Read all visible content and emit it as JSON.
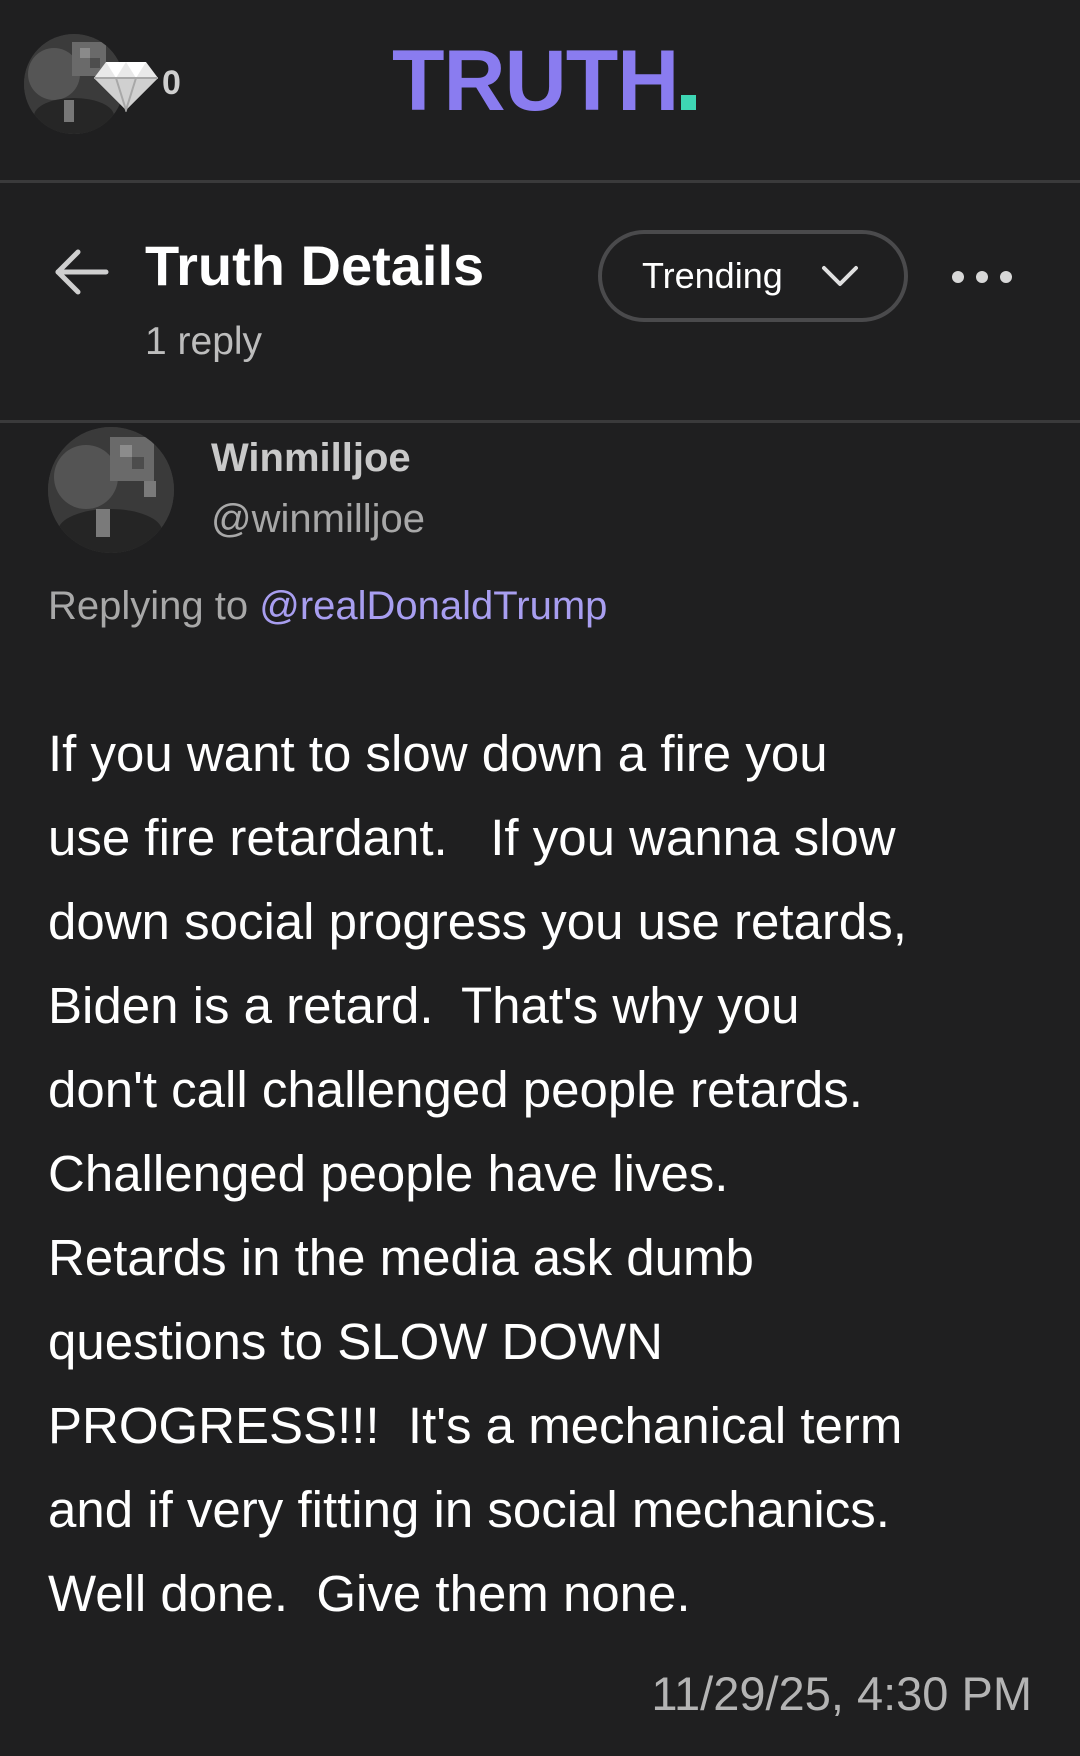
{
  "topbar": {
    "logo_text": "TRUTH",
    "diamond_count": "0",
    "user_avatar_icon": "user-avatar",
    "diamond_icon": "diamond-icon",
    "logo_color": "#8a7cf0",
    "logo_accent_color": "#3ed6b4"
  },
  "header": {
    "title": "Truth Details",
    "reply_count": "1 reply",
    "sort_label": "Trending",
    "back_icon": "arrow-left-icon",
    "sort_icon": "chevron-down-icon",
    "more_icon": "more-horizontal-icon"
  },
  "post": {
    "author_name": "Winmilljoe",
    "author_handle": "@winmilljoe",
    "replying_prefix": "Replying to ",
    "replying_to": "@realDonaldTrump",
    "body_lines": [
      "If you want to slow down a fire you",
      "use fire retardant.   If you wanna slow",
      "down social progress you use retards,",
      "Biden is a retard.  That's why you",
      "don't call challenged people retards.",
      "Challenged people have lives.",
      "Retards in the media ask dumb",
      "questions to SLOW DOWN",
      "PROGRESS!!!  It's a mechanical term",
      "and if very fitting in social mechanics.",
      "Well done.  Give them none."
    ],
    "timestamp": "11/29/25, 4:30 PM",
    "link_color": "#a89ef0"
  }
}
